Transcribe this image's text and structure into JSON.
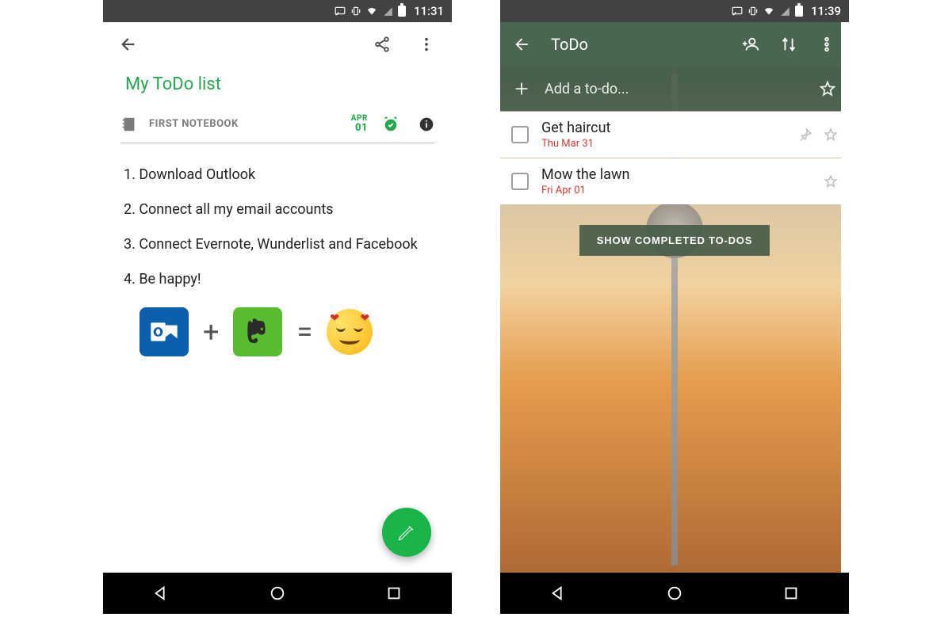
{
  "phone1": {
    "status": {
      "time": "11:31"
    },
    "note": {
      "title": "My ToDo list",
      "notebook": "FIRST NOTEBOOK",
      "reminder_month": "APR",
      "reminder_day": "01",
      "items": [
        "1. Download Outlook",
        "2. Connect all my email accounts",
        "3. Connect Evernote, Wunderlist and Facebook",
        "4. Be happy!"
      ],
      "eq_plus": "+",
      "eq_equals": "="
    }
  },
  "phone2": {
    "status": {
      "time": "11:39"
    },
    "app": {
      "title": "ToDo"
    },
    "add_placeholder": "Add a to-do...",
    "todos": [
      {
        "title": "Get haircut",
        "date": "Thu Mar 31",
        "pinned": true
      },
      {
        "title": "Mow the lawn",
        "date": "Fri Apr 01",
        "pinned": false
      }
    ],
    "show_completed": "SHOW COMPLETED TO-DOS"
  }
}
